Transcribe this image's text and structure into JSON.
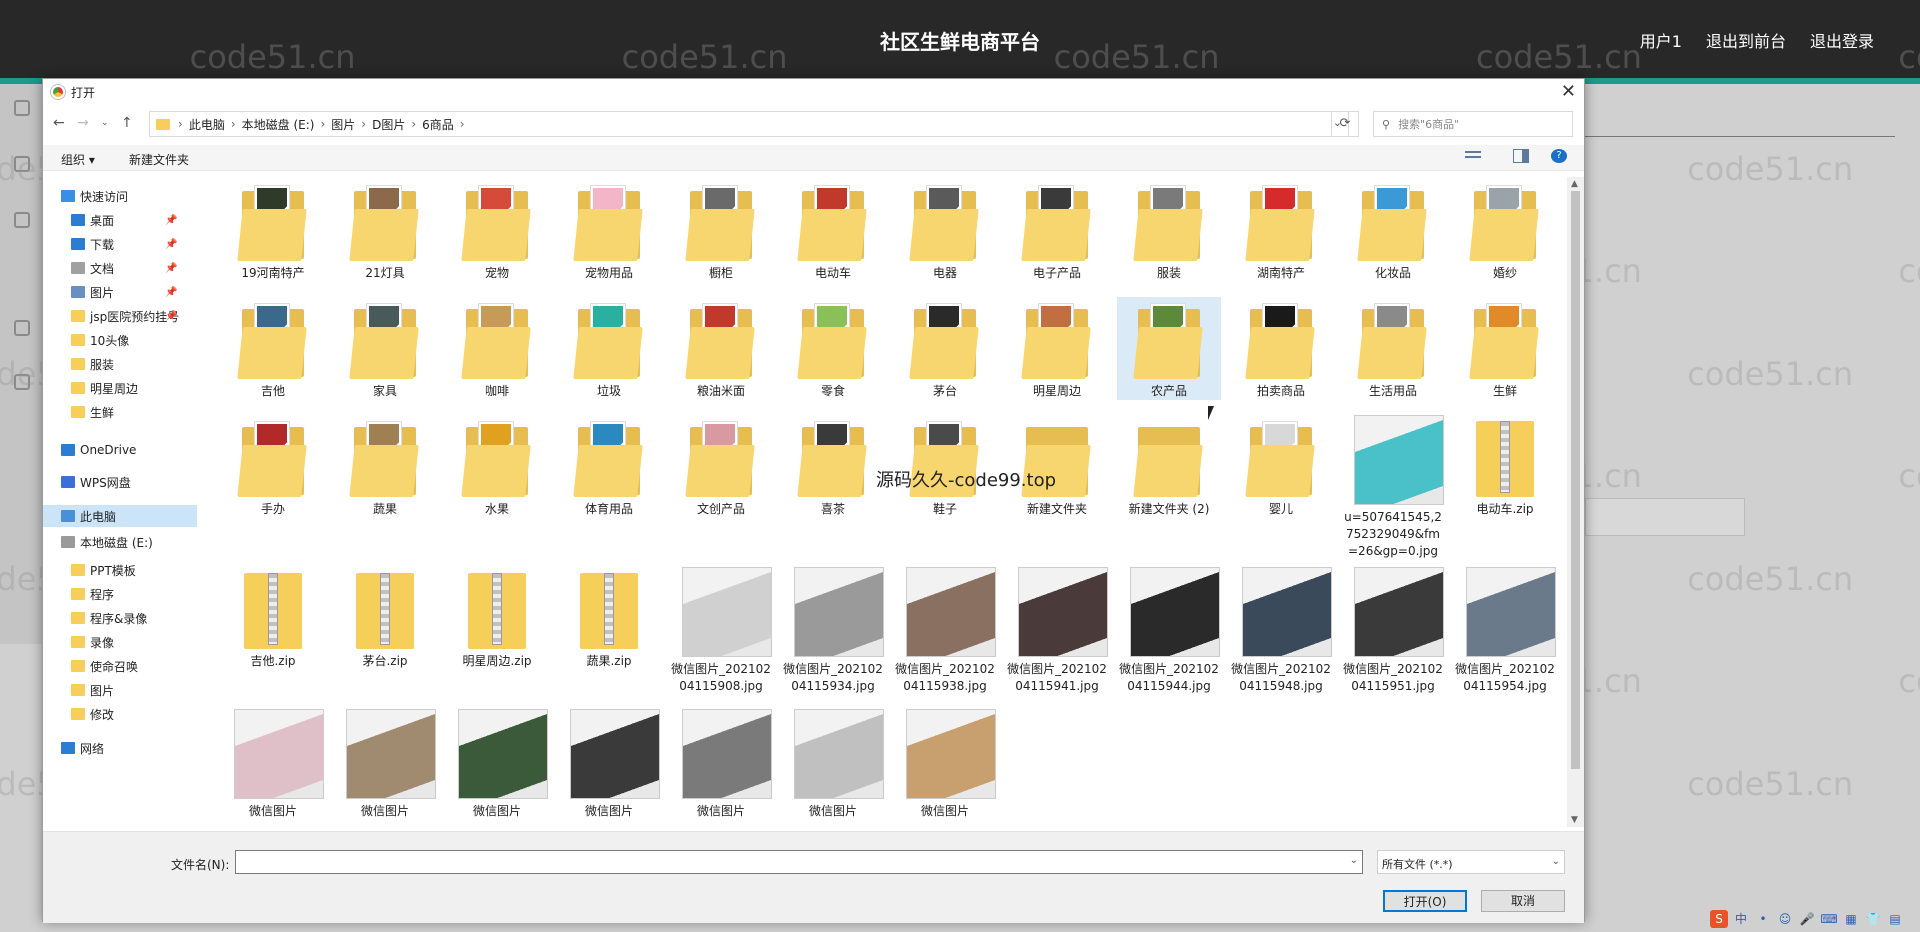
{
  "app": {
    "title": "社区生鲜电商平台",
    "nav": [
      "用户1",
      "退出到前台",
      "退出登录"
    ]
  },
  "watermark": "code51.cn",
  "overlay_text": "源码久久-code99.top",
  "dialog": {
    "title": "打开",
    "close": "✕",
    "breadcrumb": [
      "此电脑",
      "本地磁盘 (E:)",
      "图片",
      "D图片",
      "6商品"
    ],
    "search_placeholder": "搜索\"6商品\"",
    "toolbar": {
      "organize": "组织 ▾",
      "new_folder": "新建文件夹"
    },
    "nav_items": [
      {
        "label": "快速访问",
        "icon": "star-icon",
        "level": 0,
        "color": "#3a8ee6"
      },
      {
        "label": "桌面",
        "icon": "desktop-icon",
        "level": 1,
        "color": "#2b7cd3",
        "pin": "📌"
      },
      {
        "label": "下载",
        "icon": "download-icon",
        "level": 1,
        "color": "#2b7cd3",
        "pin": "📌"
      },
      {
        "label": "文档",
        "icon": "document-icon",
        "level": 1,
        "color": "#a0a0a0",
        "pin": "📌"
      },
      {
        "label": "图片",
        "icon": "pictures-icon",
        "level": 1,
        "color": "#6b8fc0",
        "pin": "📌"
      },
      {
        "label": "jsp医院预约挂号",
        "icon": "folder-icon",
        "level": 1,
        "color": "#f5cf5a",
        "pin": "📌"
      },
      {
        "label": "10头像",
        "icon": "folder-icon",
        "level": 1,
        "color": "#f5cf5a"
      },
      {
        "label": "服装",
        "icon": "folder-icon",
        "level": 1,
        "color": "#f5cf5a"
      },
      {
        "label": "明星周边",
        "icon": "folder-icon",
        "level": 1,
        "color": "#f5cf5a"
      },
      {
        "label": "生鲜",
        "icon": "folder-icon",
        "level": 1,
        "color": "#f5cf5a"
      },
      {
        "label": "OneDrive",
        "icon": "cloud-icon",
        "level": 0,
        "color": "#2b7cd3"
      },
      {
        "label": "WPS网盘",
        "icon": "cloud-icon",
        "level": 0,
        "color": "#3a6fd8"
      },
      {
        "label": "此电脑",
        "icon": "computer-icon",
        "level": 0,
        "color": "#4a8fd8",
        "selected": true
      },
      {
        "label": "本地磁盘 (E:)",
        "icon": "drive-icon",
        "level": 0,
        "color": "#9a9a9a"
      },
      {
        "label": "PPT模板",
        "icon": "folder-icon",
        "level": 1,
        "color": "#f5cf5a"
      },
      {
        "label": "程序",
        "icon": "folder-icon",
        "level": 1,
        "color": "#f5cf5a"
      },
      {
        "label": "程序&录像",
        "icon": "folder-icon",
        "level": 1,
        "color": "#f5cf5a"
      },
      {
        "label": "录像",
        "icon": "folder-icon",
        "level": 1,
        "color": "#f5cf5a"
      },
      {
        "label": "使命召唤",
        "icon": "folder-icon",
        "level": 1,
        "color": "#f5cf5a"
      },
      {
        "label": "图片",
        "icon": "folder-icon",
        "level": 1,
        "color": "#f5cf5a"
      },
      {
        "label": "修改",
        "icon": "folder-icon",
        "level": 1,
        "color": "#f5cf5a"
      },
      {
        "label": "网络",
        "icon": "network-icon",
        "level": 0,
        "color": "#2b7cd3"
      }
    ],
    "items": [
      {
        "label": "19河南特产",
        "type": "folder",
        "color": "#2e3b2a"
      },
      {
        "label": "21灯具",
        "type": "folder",
        "color": "#8a6a4a"
      },
      {
        "label": "宠物",
        "type": "folder",
        "color": "#d64a3a"
      },
      {
        "label": "宠物用品",
        "type": "folder",
        "color": "#f2b6c8"
      },
      {
        "label": "橱柜",
        "type": "folder",
        "color": "#6a6a6a"
      },
      {
        "label": "电动车",
        "type": "folder",
        "color": "#c0392b"
      },
      {
        "label": "电器",
        "type": "folder",
        "color": "#5a5a5a"
      },
      {
        "label": "电子产品",
        "type": "folder",
        "color": "#3a3a3a"
      },
      {
        "label": "服装",
        "type": "folder",
        "color": "#7a7a7a"
      },
      {
        "label": "湖南特产",
        "type": "folder",
        "color": "#d62b2b"
      },
      {
        "label": "化妆品",
        "type": "folder",
        "color": "#3a9ad6"
      },
      {
        "label": "婚纱",
        "type": "folder",
        "color": "#9aa3a8"
      },
      {
        "label": "吉他",
        "type": "folder",
        "color": "#3a6a8a"
      },
      {
        "label": "家具",
        "type": "folder",
        "color": "#4a5a5a"
      },
      {
        "label": "咖啡",
        "type": "folder",
        "color": "#c89a5a"
      },
      {
        "label": "垃圾",
        "type": "folder",
        "color": "#2bb0a0"
      },
      {
        "label": "粮油米面",
        "type": "folder",
        "color": "#c0392b"
      },
      {
        "label": "零食",
        "type": "folder",
        "color": "#8ac05a"
      },
      {
        "label": "茅台",
        "type": "folder",
        "color": "#2a2a2a"
      },
      {
        "label": "明星周边",
        "type": "folder",
        "color": "#c07040"
      },
      {
        "label": "农产品",
        "type": "folder",
        "color": "#5a8a3a",
        "selected": true
      },
      {
        "label": "拍卖商品",
        "type": "folder",
        "color": "#1a1a1a"
      },
      {
        "label": "生活用品",
        "type": "folder",
        "color": "#8a8a8a"
      },
      {
        "label": "生鲜",
        "type": "folder",
        "color": "#e08a2a"
      },
      {
        "label": "手办",
        "type": "folder",
        "color": "#b02a2a"
      },
      {
        "label": "蔬果",
        "type": "folder",
        "color": "#a08050"
      },
      {
        "label": "水果",
        "type": "folder",
        "color": "#e0a020"
      },
      {
        "label": "体育用品",
        "type": "folder",
        "color": "#2a8ac0"
      },
      {
        "label": "文创产品",
        "type": "folder",
        "color": "#d89aa0"
      },
      {
        "label": "喜茶",
        "type": "folder",
        "color": "#3a3a3a"
      },
      {
        "label": "鞋子",
        "type": "folder",
        "color": "#4a4a4a"
      },
      {
        "label": "新建文件夹",
        "type": "empty-folder",
        "color": "#f5cf5a"
      },
      {
        "label": "新建文件夹 (2)",
        "type": "empty-folder",
        "color": "#f5cf5a"
      },
      {
        "label": "婴儿",
        "type": "folder",
        "color": "#d8d8d8"
      },
      {
        "label": "u=507641545,2752329049&fm=26&gp=0.jpg",
        "type": "image",
        "color": "#4ac0c8"
      },
      {
        "label": "电动车.zip",
        "type": "zip",
        "color": "#f5cf5a"
      },
      {
        "label": "吉他.zip",
        "type": "zip",
        "color": "#f5cf5a"
      },
      {
        "label": "茅台.zip",
        "type": "zip",
        "color": "#f5cf5a"
      },
      {
        "label": "明星周边.zip",
        "type": "zip",
        "color": "#f5cf5a"
      },
      {
        "label": "蔬果.zip",
        "type": "zip",
        "color": "#f5cf5a"
      },
      {
        "label": "微信图片_20210204115908.jpg",
        "type": "image",
        "color": "#d0d0d0"
      },
      {
        "label": "微信图片_20210204115934.jpg",
        "type": "image",
        "color": "#9a9a9a"
      },
      {
        "label": "微信图片_20210204115938.jpg",
        "type": "image",
        "color": "#8a7060"
      },
      {
        "label": "微信图片_20210204115941.jpg",
        "type": "image",
        "color": "#4a3a3a"
      },
      {
        "label": "微信图片_20210204115944.jpg",
        "type": "image",
        "color": "#2a2a2a"
      },
      {
        "label": "微信图片_20210204115948.jpg",
        "type": "image",
        "color": "#3a4a5a"
      },
      {
        "label": "微信图片_20210204115951.jpg",
        "type": "image",
        "color": "#3a3a3a"
      },
      {
        "label": "微信图片_20210204115954.jpg",
        "type": "image",
        "color": "#6a7a8a"
      },
      {
        "label": "微信图片",
        "type": "image",
        "color": "#e0c0c8"
      },
      {
        "label": "微信图片",
        "type": "image",
        "color": "#a08a70"
      },
      {
        "label": "微信图片",
        "type": "image",
        "color": "#3a5a3a"
      },
      {
        "label": "微信图片",
        "type": "image",
        "color": "#3a3a3a"
      },
      {
        "label": "微信图片",
        "type": "image",
        "color": "#7a7a7a"
      },
      {
        "label": "微信图片",
        "type": "image",
        "color": "#c0c0c0"
      },
      {
        "label": "微信图片",
        "type": "image",
        "color": "#c8a070"
      }
    ],
    "filename_label": "文件名(N):",
    "filename_value": "",
    "filetype": "所有文件 (*.*)",
    "open_button": "打开(O)",
    "cancel_button": "取消"
  },
  "tray": [
    "S",
    "中",
    "•",
    "☺",
    "🎤",
    "⌨",
    "▦",
    "👕",
    "▤"
  ]
}
